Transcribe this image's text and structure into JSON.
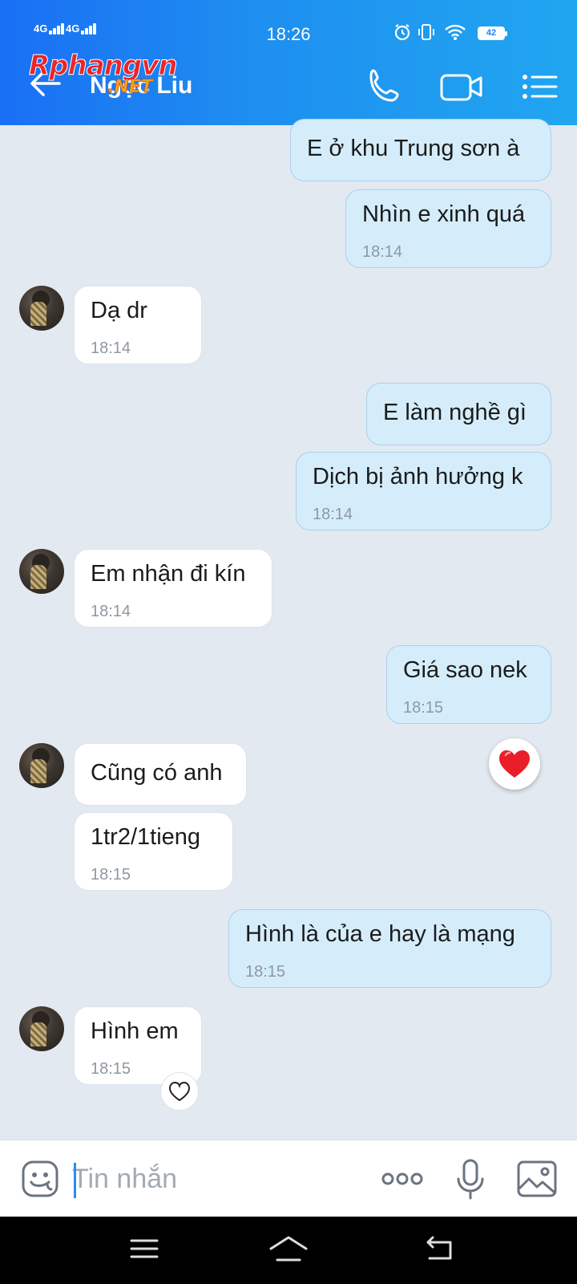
{
  "status_bar": {
    "signal_1": "4G",
    "signal_2": "4G",
    "time": "18:26",
    "battery": "42",
    "icons": [
      "alarm-icon",
      "vibrate-icon",
      "wifi-icon",
      "battery-icon"
    ]
  },
  "header": {
    "contact_name": "Ngọc Liu",
    "watermark_main": "Rphangvn",
    "watermark_sub": ".NET",
    "icons": [
      "back-arrow-icon",
      "phone-icon",
      "video-call-icon",
      "menu-list-icon"
    ]
  },
  "messages": [
    {
      "sender": "me",
      "text": "E ở  khu Trung sơn à",
      "time": ""
    },
    {
      "sender": "me",
      "text": "Nhìn e xinh quá",
      "time": "18:14"
    },
    {
      "sender": "them",
      "text": "Dạ dr",
      "time": "18:14"
    },
    {
      "sender": "me",
      "text": "E làm nghề gì",
      "time": ""
    },
    {
      "sender": "me",
      "text": "Dịch bị ảnh hưởng k",
      "time": "18:14"
    },
    {
      "sender": "them",
      "text": "Em nhận đi kín",
      "time": "18:14"
    },
    {
      "sender": "me",
      "text": "Giá sao nek",
      "time": "18:15"
    },
    {
      "sender": "them",
      "text": "Cũng có anh",
      "time": ""
    },
    {
      "sender": "them",
      "text": "1tr2/1tieng",
      "time": "18:15"
    },
    {
      "sender": "me",
      "text": "Hình là của e hay là mạng",
      "time": "18:15"
    },
    {
      "sender": "them",
      "text": "Hình em",
      "time": "18:15"
    }
  ],
  "reaction": {
    "icon": "red-heart-icon"
  },
  "react_button": {
    "icon": "heart-outline-icon"
  },
  "composer": {
    "placeholder": "Tin nhắn",
    "icons": [
      "emoji-icon",
      "more-icon",
      "microphone-icon",
      "image-icon"
    ]
  },
  "colors": {
    "header_gradient_start": "#1a6ff4",
    "header_gradient_end": "#20a6f0",
    "my_bubble": "#d5edfb",
    "their_bubble": "#ffffff",
    "chat_background": "#e2e9f1",
    "accent": "#2a8cf0"
  }
}
